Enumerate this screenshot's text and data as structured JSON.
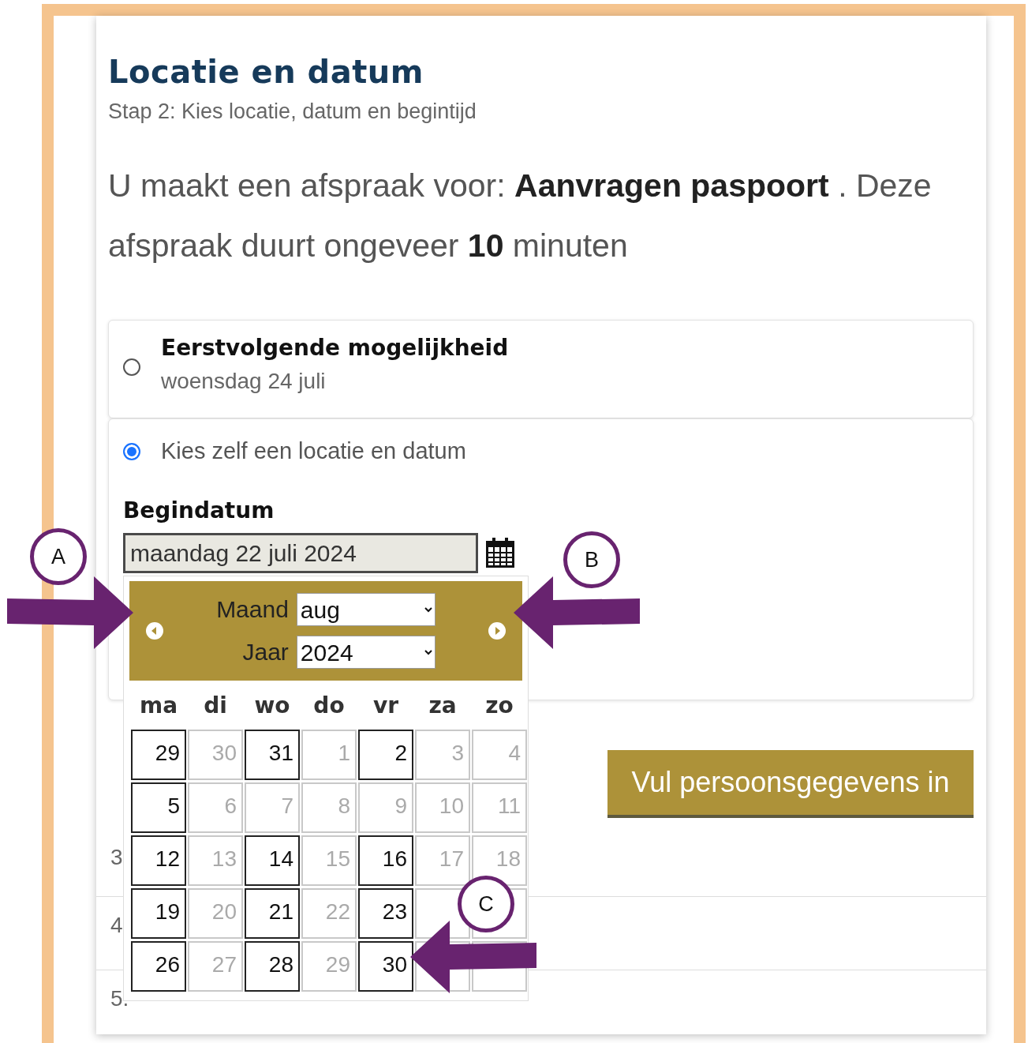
{
  "page": {
    "title": "Locatie en datum",
    "subtitle": "Stap 2: Kies locatie, datum en begintijd",
    "intro": "U maakt een afspraak voor: **Aanvragen paspoort** . Deze afspraak duurt ongeveer **10** minuten"
  },
  "options": [
    {
      "kind": "summary",
      "label": "Eerstvolgende mogelijkheid",
      "detail": "woensdag 24 juli",
      "selected": false
    },
    {
      "kind": "plain",
      "label": "Kies zelf een locatie en datum",
      "selected": true
    }
  ],
  "date_field": {
    "label": "Begindatum",
    "value": "maandag 22 juli 2024"
  },
  "datepicker": {
    "month_label": "Maand",
    "month": "aug",
    "year_label": "Jaar",
    "year": "2024",
    "weekdays": [
      "ma",
      "di",
      "wo",
      "do",
      "vr",
      "za",
      "zo"
    ],
    "days": [
      {
        "label": "29",
        "available": true
      },
      {
        "label": "30",
        "available": false
      },
      {
        "label": "31",
        "available": true
      },
      {
        "label": "1",
        "available": false
      },
      {
        "label": "2",
        "available": true
      },
      {
        "label": "3",
        "available": false
      },
      {
        "label": "4",
        "available": false
      },
      {
        "label": "5",
        "available": true
      },
      {
        "label": "6",
        "available": false
      },
      {
        "label": "7",
        "available": false
      },
      {
        "label": "8",
        "available": false
      },
      {
        "label": "9",
        "available": false
      },
      {
        "label": "10",
        "available": false
      },
      {
        "label": "11",
        "available": false
      },
      {
        "label": "12",
        "available": true
      },
      {
        "label": "13",
        "available": false
      },
      {
        "label": "14",
        "available": true
      },
      {
        "label": "15",
        "available": false
      },
      {
        "label": "16",
        "available": true
      },
      {
        "label": "17",
        "available": false
      },
      {
        "label": "18",
        "available": false
      },
      {
        "label": "19",
        "available": true
      },
      {
        "label": "20",
        "available": false
      },
      {
        "label": "21",
        "available": true
      },
      {
        "label": "22",
        "available": false
      },
      {
        "label": "23",
        "available": true
      },
      {
        "available": false
      },
      {
        "available": false
      },
      {
        "label": "26",
        "available": true
      },
      {
        "label": "27",
        "available": false
      },
      {
        "label": "28",
        "available": true
      },
      {
        "label": "29",
        "available": false
      },
      {
        "label": "30",
        "available": true
      },
      {
        "available": false
      },
      {
        "available": false
      }
    ]
  },
  "next_button": "Vul persoonsgegevens in",
  "steps": [
    "3",
    "4",
    "5."
  ],
  "annotations": [
    "A",
    "B",
    "C"
  ]
}
